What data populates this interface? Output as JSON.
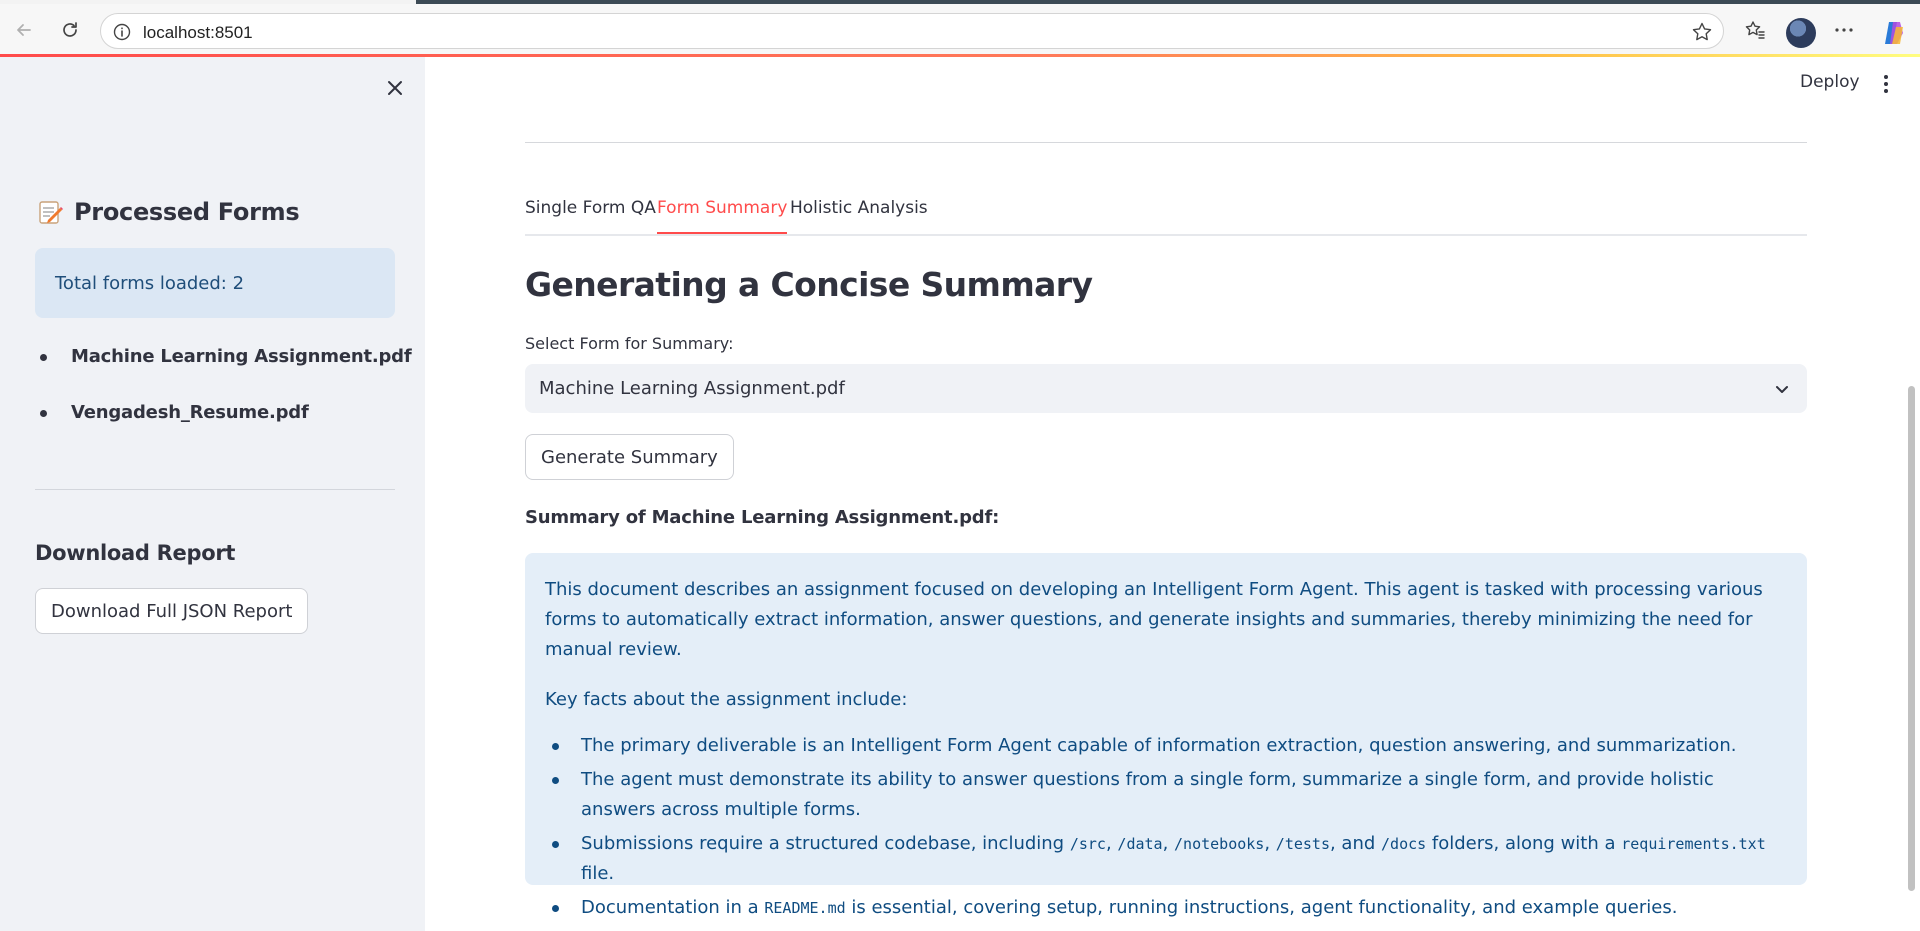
{
  "browser": {
    "url": "localhost:8501"
  },
  "header": {
    "deploy_label": "Deploy"
  },
  "sidebar": {
    "heading": "Processed Forms",
    "total_forms": "Total forms loaded: 2",
    "files": [
      "Machine Learning Assignment.pdf",
      "Vengadesh_Resume.pdf"
    ],
    "download_heading": "Download Report",
    "download_button": "Download Full JSON Report"
  },
  "main": {
    "tabs": [
      {
        "label": "Single Form QA",
        "active": false
      },
      {
        "label": "Form Summary",
        "active": true
      },
      {
        "label": "Holistic Analysis",
        "active": false
      }
    ],
    "title": "Generating a Concise Summary",
    "select_label": "Select Form for Summary:",
    "select_value": "Machine Learning Assignment.pdf",
    "generate_button": "Generate Summary",
    "summary_heading": "Summary of Machine Learning Assignment.pdf:",
    "summary": {
      "intro": "This document describes an assignment focused on developing an Intelligent Form Agent. This agent is tasked with processing various forms to automatically extract information, answer questions, and generate insights and summaries, thereby minimizing the need for manual review.",
      "facts_label": "Key facts about the assignment include:",
      "bullet_1": "The primary deliverable is an Intelligent Form Agent capable of information extraction, question answering, and summarization.",
      "bullet_2": "The agent must demonstrate its ability to answer questions from a single form, summarize a single form, and provide holistic answers across multiple forms.",
      "bullet_3_pre": "Submissions require a structured codebase, including ",
      "bullet_3_code_1": "/src",
      "bullet_3_code_2": "/data",
      "bullet_3_code_3": "/notebooks",
      "bullet_3_code_4": "/tests",
      "bullet_3_and": ", and ",
      "bullet_3_code_5": "/docs",
      "bullet_3_mid": " folders, along with a ",
      "bullet_3_code_6": "requirements.txt",
      "bullet_3_post": " file.",
      "bullet_4_pre": "Documentation in a ",
      "bullet_4_code": "README.md",
      "bullet_4_post": " is essential, covering setup, running instructions, agent functionality, and example queries."
    }
  },
  "colors": {
    "accent": "#ff4b4b",
    "sidebar_bg": "#f0f2f6",
    "info_bg": "#dbe7f4",
    "summary_bg": "#e4eef8",
    "summary_text": "#0f4c81"
  }
}
